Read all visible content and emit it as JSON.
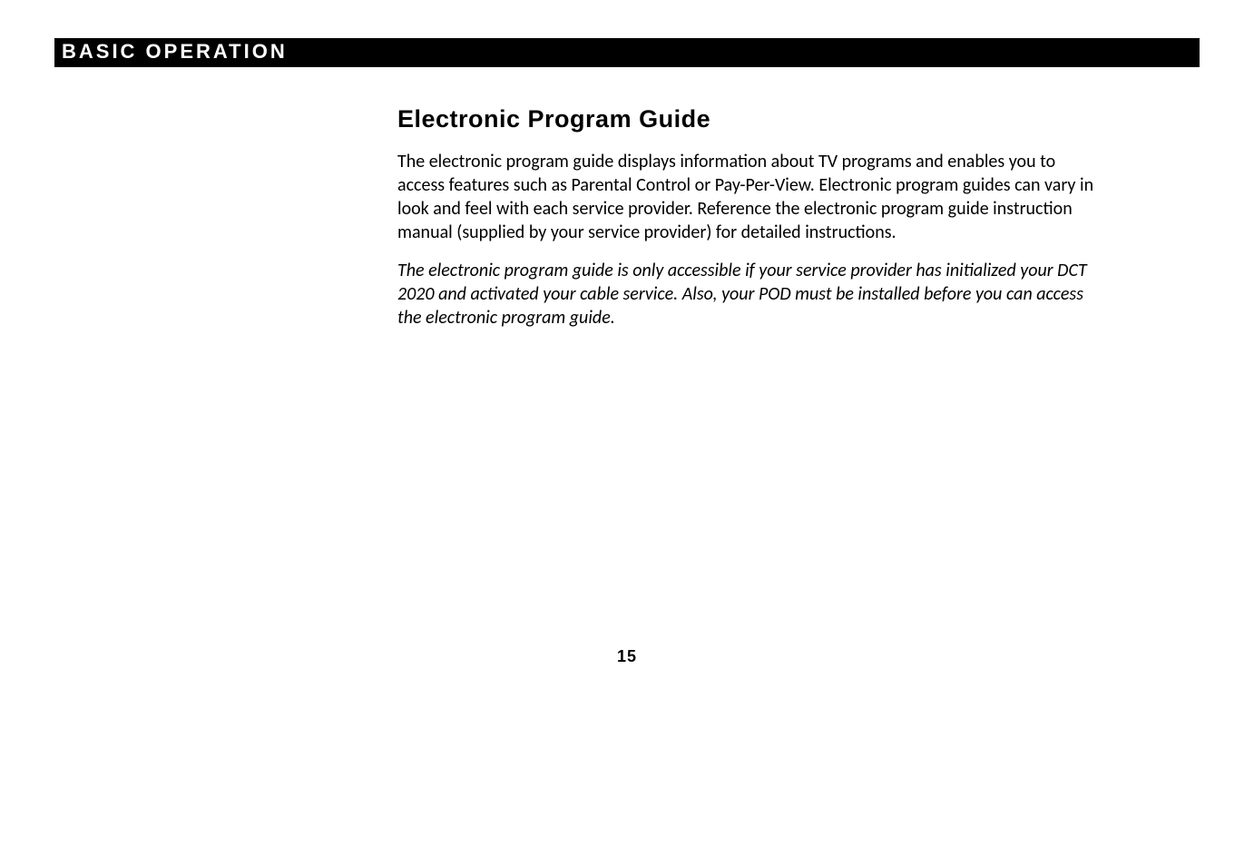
{
  "header": {
    "title": "BASIC OPERATION"
  },
  "content": {
    "section_title": "Electronic Program Guide",
    "paragraph1": "The electronic program guide displays information about TV programs and enables you to access features such as Parental Control or Pay-Per-View. Electronic program guides can vary in look and feel with each service provider. Reference the electronic program guide instruction manual (supplied by your service provider) for detailed instructions.",
    "paragraph2": "The electronic program guide is only accessible if your service provider has initialized your DCT 2020 and activated your cable service. Also, your POD must be installed before you can access the electronic program guide."
  },
  "page_number": "15"
}
